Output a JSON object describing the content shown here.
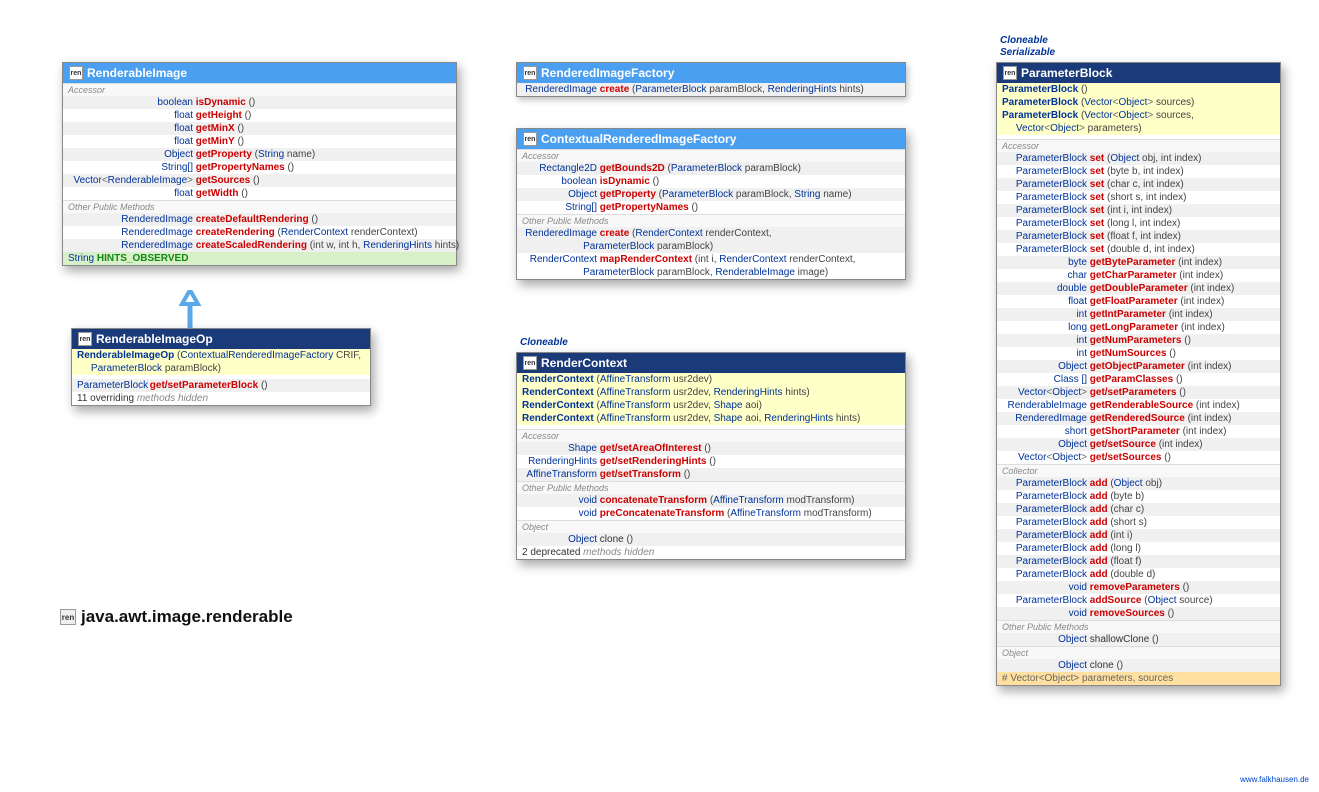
{
  "footer_link": "www.falkhausen.de",
  "package": "java.awt.image.renderable",
  "stereotypes": {
    "cloneable": "Cloneable",
    "serializable": "Serializable"
  },
  "renderableImage": {
    "title": "RenderableImage",
    "accessor": [
      {
        "rt": "boolean",
        "name": "isDynamic",
        "params": "()"
      },
      {
        "rt": "float",
        "name": "getHeight",
        "params": "()"
      },
      {
        "rt": "float",
        "name": "getMinX",
        "params": "()"
      },
      {
        "rt": "float",
        "name": "getMinY",
        "params": "()"
      },
      {
        "rt": "Object",
        "name": "getProperty",
        "params_html": "(<span class='ptype'>String</span> name)"
      },
      {
        "rt": "String[]",
        "name": "getPropertyNames",
        "params": "()"
      },
      {
        "rt_html": "<span class='ptype'>Vector</span><span class='angle'>&lt;</span><span class='ptype'>RenderableImage</span><span class='angle'>&gt;</span>",
        "name": "getSources",
        "params": "()"
      },
      {
        "rt": "float",
        "name": "getWidth",
        "params": "()"
      }
    ],
    "other": [
      {
        "rt": "RenderedImage",
        "name": "createDefaultRendering",
        "params": "()"
      },
      {
        "rt": "RenderedImage",
        "name": "createRendering",
        "params_html": "(<span class='ptype'>RenderContext</span> renderContext)"
      },
      {
        "rt": "RenderedImage",
        "name": "createScaledRendering",
        "params_html": "(int w, int h, <span class='ptype'>RenderingHints</span> hints)"
      }
    ],
    "field": {
      "type": "String",
      "name": "HINTS_OBSERVED"
    }
  },
  "renderableImageOp": {
    "title": "RenderableImageOp",
    "ctor": {
      "name": "RenderableImageOp",
      "params_html": "(<span class='ptype'>ContextualRenderedImageFactory</span> CRIF,<br>&nbsp;&nbsp;&nbsp;&nbsp;&nbsp;<span class='ptype'>ParameterBlock</span> paramBlock)"
    },
    "methods": [
      {
        "rt": "ParameterBlock",
        "name": "get/setParameterBlock",
        "params": "()"
      }
    ],
    "note": {
      "num": "11 overriding",
      "text": " methods hidden"
    }
  },
  "renderedImageFactory": {
    "title": "RenderedImageFactory",
    "methods": [
      {
        "rt": "RenderedImage",
        "name": "create",
        "params_html": "(<span class='ptype'>ParameterBlock</span> paramBlock, <span class='ptype'>RenderingHints</span> hints)"
      }
    ]
  },
  "contextualFactory": {
    "title": "ContextualRenderedImageFactory",
    "accessor": [
      {
        "rt": "Rectangle2D",
        "name": "getBounds2D",
        "params_html": "(<span class='ptype'>ParameterBlock</span> paramBlock)"
      },
      {
        "rt": "boolean",
        "name": "isDynamic",
        "params": "()"
      },
      {
        "rt": "Object",
        "name": "getProperty",
        "params_html": "(<span class='ptype'>ParameterBlock</span> paramBlock, <span class='ptype'>String</span> name)"
      },
      {
        "rt": "String[]",
        "name": "getPropertyNames",
        "params": "()"
      }
    ],
    "other": [
      {
        "rt": "RenderedImage",
        "name": "create",
        "params_html": "(<span class='ptype'>RenderContext</span> renderContext,<br>&nbsp;&nbsp;&nbsp;&nbsp;&nbsp;&nbsp;&nbsp;&nbsp;&nbsp;&nbsp;&nbsp;&nbsp;&nbsp;&nbsp;&nbsp;&nbsp;&nbsp;&nbsp;&nbsp;&nbsp;&nbsp;&nbsp;<span class='ptype'>ParameterBlock</span> paramBlock)"
      },
      {
        "rt": "RenderContext",
        "name": "mapRenderContext",
        "params_html": "(int i, <span class='ptype'>RenderContext</span> renderContext,<br>&nbsp;&nbsp;&nbsp;&nbsp;&nbsp;&nbsp;&nbsp;&nbsp;&nbsp;&nbsp;&nbsp;&nbsp;&nbsp;&nbsp;&nbsp;&nbsp;&nbsp;&nbsp;&nbsp;&nbsp;&nbsp;&nbsp;<span class='ptype'>ParameterBlock</span> paramBlock, <span class='ptype'>RenderableImage</span> image)"
      }
    ]
  },
  "renderContext": {
    "title": "RenderContext",
    "ctors": [
      {
        "name": "RenderContext",
        "params_html": "(<span class='ptype'>AffineTransform</span> usr2dev)"
      },
      {
        "name": "RenderContext",
        "params_html": "(<span class='ptype'>AffineTransform</span> usr2dev, <span class='ptype'>RenderingHints</span> hints)"
      },
      {
        "name": "RenderContext",
        "params_html": "(<span class='ptype'>AffineTransform</span> usr2dev, <span class='ptype'>Shape</span> aoi)"
      },
      {
        "name": "RenderContext",
        "params_html": "(<span class='ptype'>AffineTransform</span> usr2dev, <span class='ptype'>Shape</span> aoi, <span class='ptype'>RenderingHints</span> hints)"
      }
    ],
    "accessor": [
      {
        "rt": "Shape",
        "name": "get/setAreaOfInterest",
        "params": "()"
      },
      {
        "rt": "RenderingHints",
        "name": "get/setRenderingHints",
        "params": "()"
      },
      {
        "rt": "AffineTransform",
        "name": "get/setTransform",
        "params": "()"
      }
    ],
    "other": [
      {
        "rt": "void",
        "name": "concatenateTransform",
        "params_html": "(<span class='ptype'>AffineTransform</span> modTransform)"
      },
      {
        "rt": "void",
        "name": "preConcatenateTransform",
        "params_html": "(<span class='ptype'>AffineTransform</span> modTransform)"
      }
    ],
    "object": [
      {
        "rt": "Object",
        "name_plain": "clone",
        "params": "()"
      }
    ],
    "note": {
      "num": "2 deprecated",
      "text": " methods hidden"
    }
  },
  "parameterBlock": {
    "title": "ParameterBlock",
    "ctors": [
      {
        "name": "ParameterBlock",
        "params": "()"
      },
      {
        "name": "ParameterBlock",
        "params_html": "(<span class='ptype'>Vector</span><span class='angle'>&lt;</span><span class='ptype'>Object</span><span class='angle'>&gt;</span> sources)"
      },
      {
        "name": "ParameterBlock",
        "params_html": "(<span class='ptype'>Vector</span><span class='angle'>&lt;</span><span class='ptype'>Object</span><span class='angle'>&gt;</span> sources,<br>&nbsp;&nbsp;&nbsp;&nbsp;&nbsp;<span class='ptype'>Vector</span><span class='angle'>&lt;</span><span class='ptype'>Object</span><span class='angle'>&gt;</span> parameters)"
      }
    ],
    "accessor": [
      {
        "rt": "ParameterBlock",
        "name": "set",
        "params_html": "(<span class='ptype'>Object</span> obj, int index)"
      },
      {
        "rt": "ParameterBlock",
        "name": "set",
        "params_html": "(byte b, int index)"
      },
      {
        "rt": "ParameterBlock",
        "name": "set",
        "params_html": "(char c, int index)"
      },
      {
        "rt": "ParameterBlock",
        "name": "set",
        "params_html": "(short s, int index)"
      },
      {
        "rt": "ParameterBlock",
        "name": "set",
        "params_html": "(int i, int index)"
      },
      {
        "rt": "ParameterBlock",
        "name": "set",
        "params_html": "(long l, int index)"
      },
      {
        "rt": "ParameterBlock",
        "name": "set",
        "params_html": "(float f, int index)"
      },
      {
        "rt": "ParameterBlock",
        "name": "set",
        "params_html": "(double d, int index)"
      },
      {
        "rt": "byte",
        "name": "getByteParameter",
        "params_html": "(int index)"
      },
      {
        "rt": "char",
        "name": "getCharParameter",
        "params_html": "(int index)"
      },
      {
        "rt": "double",
        "name": "getDoubleParameter",
        "params_html": "(int index)"
      },
      {
        "rt": "float",
        "name": "getFloatParameter",
        "params_html": "(int index)"
      },
      {
        "rt": "int",
        "name": "getIntParameter",
        "params_html": "(int index)"
      },
      {
        "rt": "long",
        "name": "getLongParameter",
        "params_html": "(int index)"
      },
      {
        "rt": "int",
        "name": "getNumParameters",
        "params": "()"
      },
      {
        "rt": "int",
        "name": "getNumSources",
        "params": "()"
      },
      {
        "rt": "Object",
        "name": "getObjectParameter",
        "params_html": "(int index)"
      },
      {
        "rt": "Class []",
        "name": "getParamClasses",
        "params": "()"
      },
      {
        "rt_html": "<span class='ptype'>Vector</span><span class='angle'>&lt;</span><span class='ptype'>Object</span><span class='angle'>&gt;</span>",
        "name": "get/setParameters",
        "params": "()"
      },
      {
        "rt": "RenderableImage",
        "name": "getRenderableSource",
        "params_html": "(int index)"
      },
      {
        "rt": "RenderedImage",
        "name": "getRenderedSource",
        "params_html": "(int index)"
      },
      {
        "rt": "short",
        "name": "getShortParameter",
        "params_html": "(int index)"
      },
      {
        "rt": "Object",
        "name": "get/setSource",
        "params_html": "(int index)"
      },
      {
        "rt_html": "<span class='ptype'>Vector</span><span class='angle'>&lt;</span><span class='ptype'>Object</span><span class='angle'>&gt;</span>",
        "name": "get/setSources",
        "params": "()"
      }
    ],
    "collector": [
      {
        "rt": "ParameterBlock",
        "name": "add",
        "params_html": "(<span class='ptype'>Object</span> obj)"
      },
      {
        "rt": "ParameterBlock",
        "name": "add",
        "params_html": "(byte b)"
      },
      {
        "rt": "ParameterBlock",
        "name": "add",
        "params_html": "(char c)"
      },
      {
        "rt": "ParameterBlock",
        "name": "add",
        "params_html": "(short s)"
      },
      {
        "rt": "ParameterBlock",
        "name": "add",
        "params_html": "(int i)"
      },
      {
        "rt": "ParameterBlock",
        "name": "add",
        "params_html": "(long l)"
      },
      {
        "rt": "ParameterBlock",
        "name": "add",
        "params_html": "(float f)"
      },
      {
        "rt": "ParameterBlock",
        "name": "add",
        "params_html": "(double d)"
      },
      {
        "rt": "void",
        "name": "removeParameters",
        "params": "()"
      },
      {
        "rt": "ParameterBlock",
        "name": "addSource",
        "params_html": "(<span class='ptype'>Object</span> source)"
      },
      {
        "rt": "void",
        "name": "removeSources",
        "params": "()"
      }
    ],
    "other": [
      {
        "rt": "Object",
        "name_plain": "shallowClone",
        "params": "()"
      }
    ],
    "object": [
      {
        "rt": "Object",
        "name_plain": "clone",
        "params": "()"
      }
    ],
    "proto": "# Vector<Object> parameters, sources"
  },
  "labels": {
    "accessor": "Accessor",
    "other": "Other Public Methods",
    "object": "Object",
    "collector": "Collector"
  }
}
